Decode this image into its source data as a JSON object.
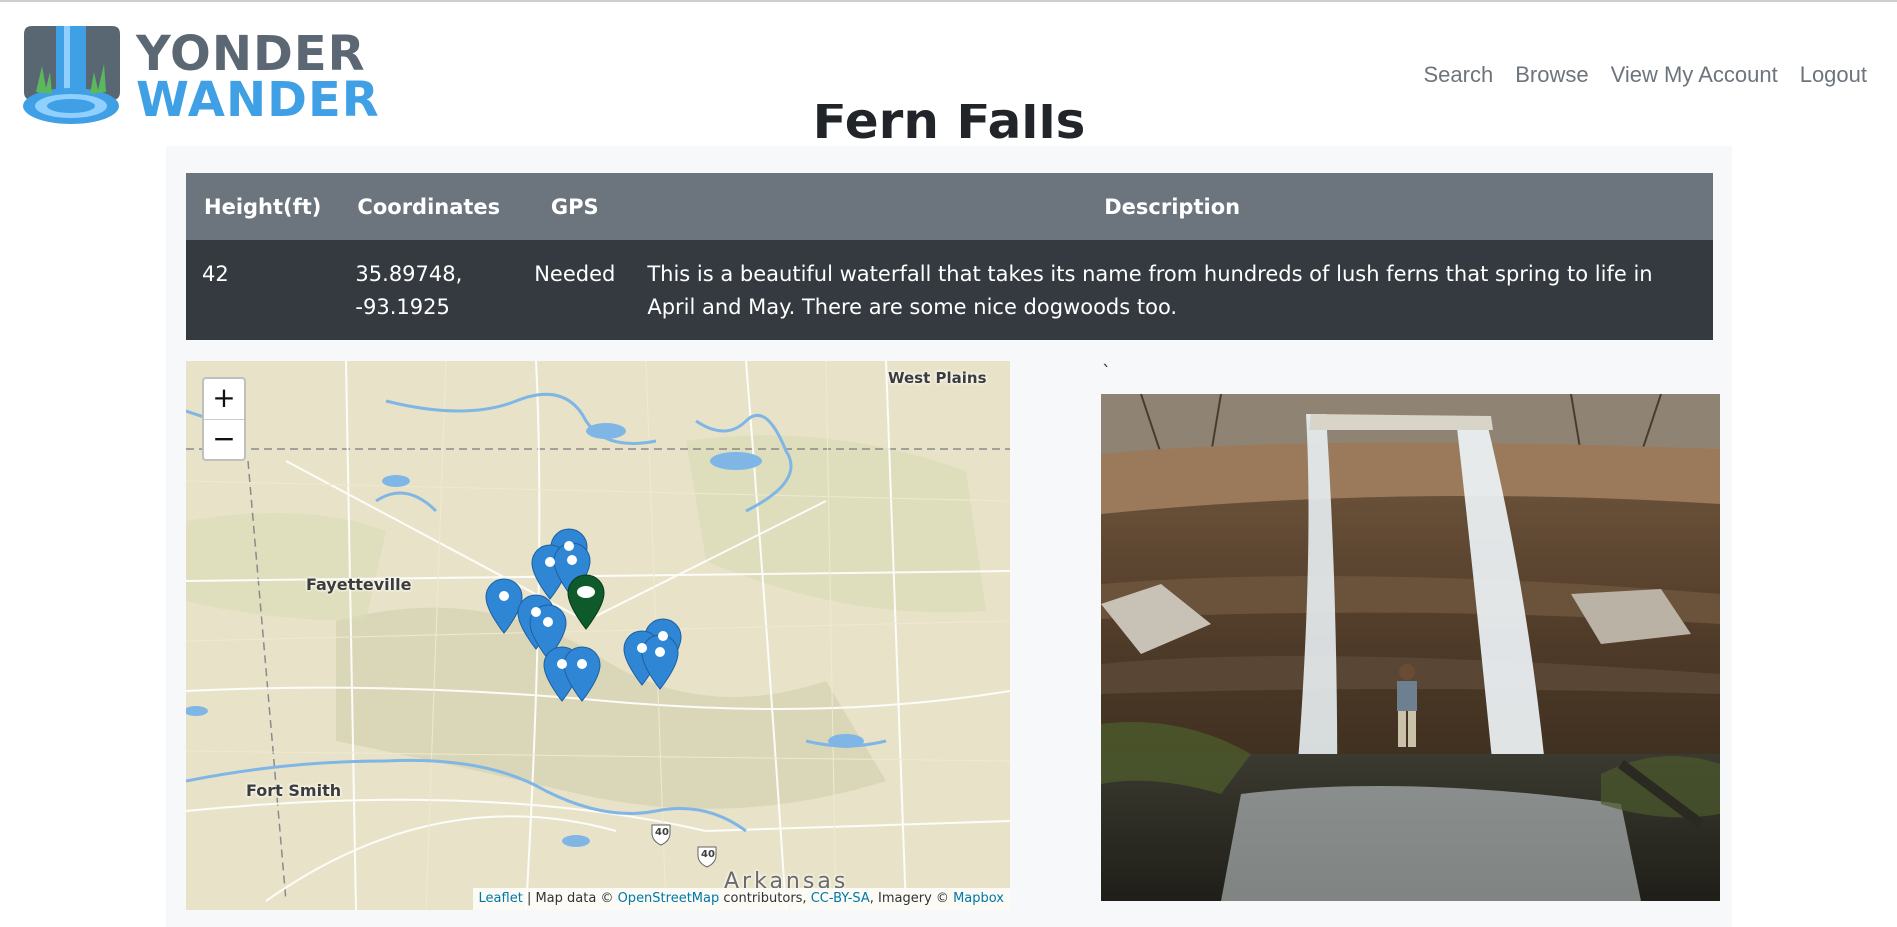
{
  "brand": {
    "line1": "YONDER",
    "line2": "WANDER"
  },
  "nav": [
    "Search",
    "Browse",
    "View My Account",
    "Logout"
  ],
  "page": {
    "title": "Fern Falls"
  },
  "table": {
    "headers": [
      "Height(ft)",
      "Coordinates",
      "GPS",
      "Description"
    ],
    "row": {
      "height": "42",
      "coord_lat": "35.89748,",
      "coord_lon": "-93.1925",
      "gps": "Needed",
      "description": "This is a beautiful waterfall that takes its name from hundreds of lush ferns that spring to life in April and May. There are some nice dogwoods too."
    }
  },
  "map": {
    "zoom_in": "+",
    "zoom_out": "−",
    "labels": {
      "west_plains": "West Plains",
      "fayetteville": "Fayetteville",
      "fort_smith": "Fort Smith",
      "arkansas": "Arkansas",
      "highway_1": "40",
      "highway_2": "40"
    },
    "attribution": {
      "leaflet": "Leaflet",
      "sep1": " | Map data © ",
      "osm": "OpenStreetMap",
      "sep2": " contributors, ",
      "license": "CC-BY-SA",
      "sep3": ", Imagery © ",
      "mapbox": "Mapbox"
    },
    "colors": {
      "marker": "#2f86d4",
      "selected_marker": "#0f5a2a",
      "water": "#7fb6e6"
    }
  },
  "image_caption_mark": "`"
}
